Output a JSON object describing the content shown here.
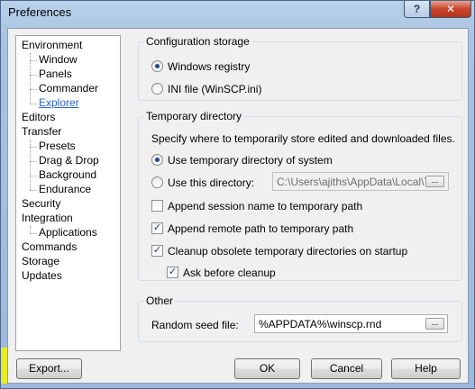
{
  "window": {
    "title": "Preferences",
    "help_label": "?",
    "close_label": "✕"
  },
  "tree": [
    {
      "label": "Environment",
      "level": 0
    },
    {
      "label": "Window",
      "level": 1
    },
    {
      "label": "Panels",
      "level": 1
    },
    {
      "label": "Commander",
      "level": 1
    },
    {
      "label": "Explorer",
      "level": 1,
      "selected": true
    },
    {
      "label": "Editors",
      "level": 0
    },
    {
      "label": "Transfer",
      "level": 0
    },
    {
      "label": "Presets",
      "level": 1
    },
    {
      "label": "Drag & Drop",
      "level": 1
    },
    {
      "label": "Background",
      "level": 1
    },
    {
      "label": "Endurance",
      "level": 1
    },
    {
      "label": "Security",
      "level": 0
    },
    {
      "label": "Integration",
      "level": 0
    },
    {
      "label": "Applications",
      "level": 1
    },
    {
      "label": "Commands",
      "level": 0
    },
    {
      "label": "Storage",
      "level": 0
    },
    {
      "label": "Updates",
      "level": 0
    }
  ],
  "config_storage": {
    "legend": "Configuration storage",
    "opt_registry": "Windows registry",
    "opt_ini": "INI file (WinSCP.ini)",
    "selected": "registry"
  },
  "temp_dir": {
    "legend": "Temporary directory",
    "description": "Specify where to temporarily store edited and downloaded files.",
    "opt_system": "Use temporary directory of system",
    "opt_this": "Use this directory:",
    "path_value": "C:\\Users\\ajiths\\AppData\\Local\\T",
    "browse_label": "...",
    "append_session": "Append session name to temporary path",
    "append_session_checked": false,
    "append_remote": "Append remote path to temporary path",
    "append_remote_checked": true,
    "cleanup": "Cleanup obsolete temporary directories on startup",
    "cleanup_checked": true,
    "ask_before": "Ask before cleanup",
    "ask_before_checked": true
  },
  "other": {
    "legend": "Other",
    "seed_label": "Random seed file:",
    "seed_value": "%APPDATA%\\winscp.rnd",
    "browse_label": "..."
  },
  "buttons": {
    "export": "Export...",
    "ok": "OK",
    "cancel": "Cancel",
    "help": "Help"
  },
  "colors": {
    "highlight": "#f4f600",
    "selected_link": "#2a62c9"
  }
}
